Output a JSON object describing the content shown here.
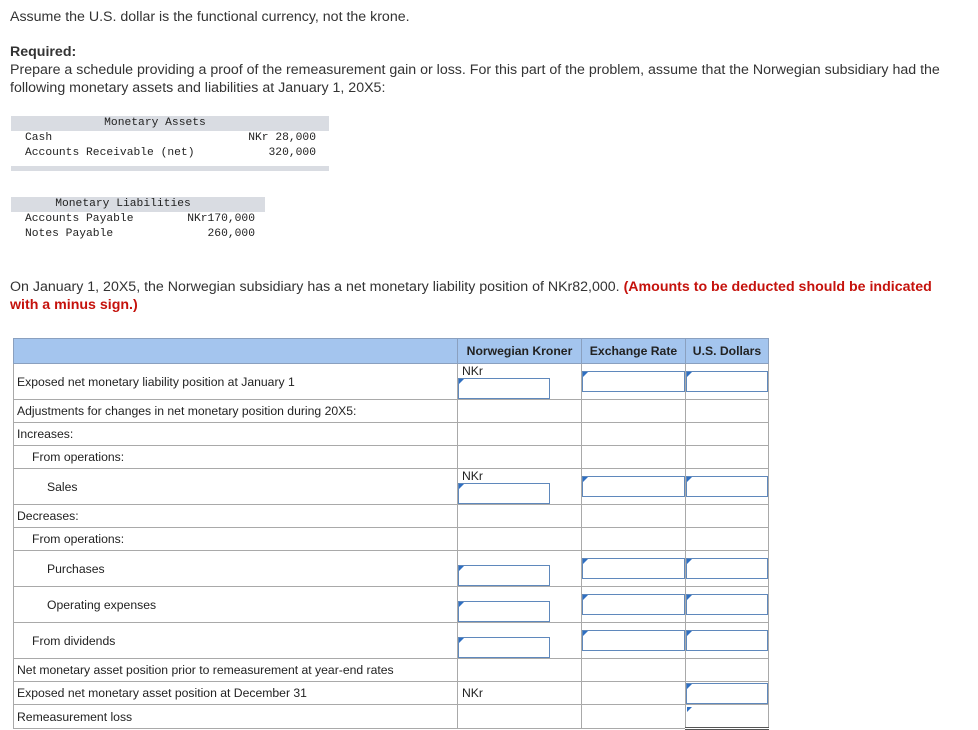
{
  "intro": "Assume the U.S. dollar is the functional currency, not the krone.",
  "required_label": "Required:",
  "required_text": "Prepare a schedule providing a proof of the remeasurement gain or loss. For this part of the problem, assume that the Norwegian subsidiary had the following monetary assets and liabilities at January 1, 20X5:",
  "assets": {
    "header": "Monetary Assets",
    "rows": [
      {
        "label": "Cash",
        "value": "NKr 28,000"
      },
      {
        "label": "Accounts Receivable (net)",
        "value": "320,000"
      }
    ]
  },
  "liabilities": {
    "header": "Monetary Liabilities",
    "rows": [
      {
        "label": "Accounts Payable",
        "value": "NKr170,000"
      },
      {
        "label": "Notes Payable",
        "value": "260,000"
      }
    ]
  },
  "statement": "On January 1, 20X5, the Norwegian subsidiary has a net monetary liability position of NKr82,000.",
  "note": "(Amounts to be deducted should be indicated with a minus sign.)",
  "table": {
    "headers": [
      "Norwegian Kroner",
      "Exchange Rate",
      "U.S. Dollars"
    ],
    "currency": "NKr",
    "rows": [
      "Exposed net monetary liability position at January 1",
      "Adjustments for changes in net monetary position during 20X5:",
      "Increases:",
      "From operations:",
      "Sales",
      "Decreases:",
      "From operations:",
      "Purchases",
      "Operating expenses",
      "From dividends",
      "Net monetary asset position prior to remeasurement at year-end rates",
      "Exposed net monetary asset position at December 31",
      "Remeasurement loss"
    ]
  }
}
